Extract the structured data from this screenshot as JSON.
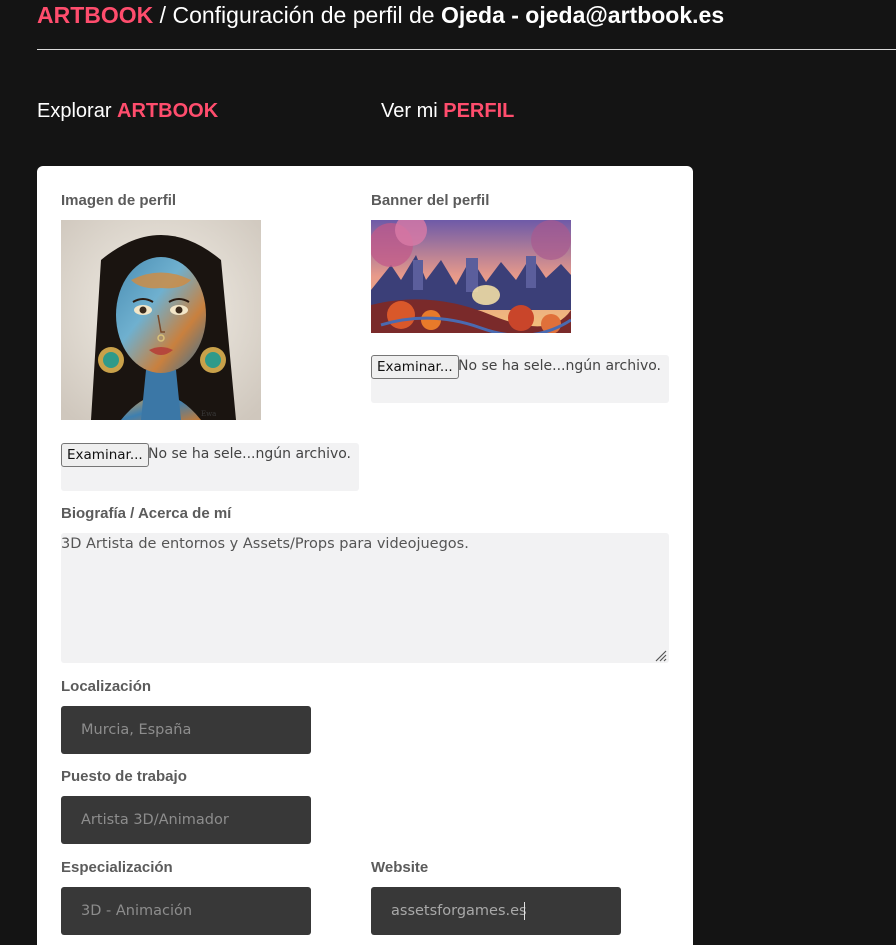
{
  "header": {
    "brand": "ARTBOOK",
    "separator": " / ",
    "title_prefix": "Configuración de perfil de ",
    "user": "Ojeda - ojeda@artbook.es"
  },
  "nav": {
    "explore_prefix": "Explorar ",
    "explore_accent": "ARTBOOK",
    "profile_prefix": "Ver mi ",
    "profile_accent": "PERFIL"
  },
  "form": {
    "profile_image_label": "Imagen de perfil",
    "banner_label": "Banner del perfil",
    "browse_button": "Examinar...",
    "no_file": "No se ha sele...ngún archivo.",
    "bio_label": "Biografía / Acerca de mí",
    "bio_value": "3D Artista de entornos y Assets/Props para videojuegos.",
    "location_label": "Localización",
    "location_placeholder": "Murcia, España",
    "job_label": "Puesto de trabajo",
    "job_placeholder": "Artista 3D/Animador",
    "specialization_label": "Especialización",
    "specialization_placeholder": "3D - Animación",
    "website_label": "Website",
    "website_value": "assetsforgames.es"
  },
  "colors": {
    "accent": "#ff4d6d",
    "background": "#141414",
    "card": "#ffffff",
    "input_dark": "#383838",
    "input_light": "#f2f2f3"
  }
}
